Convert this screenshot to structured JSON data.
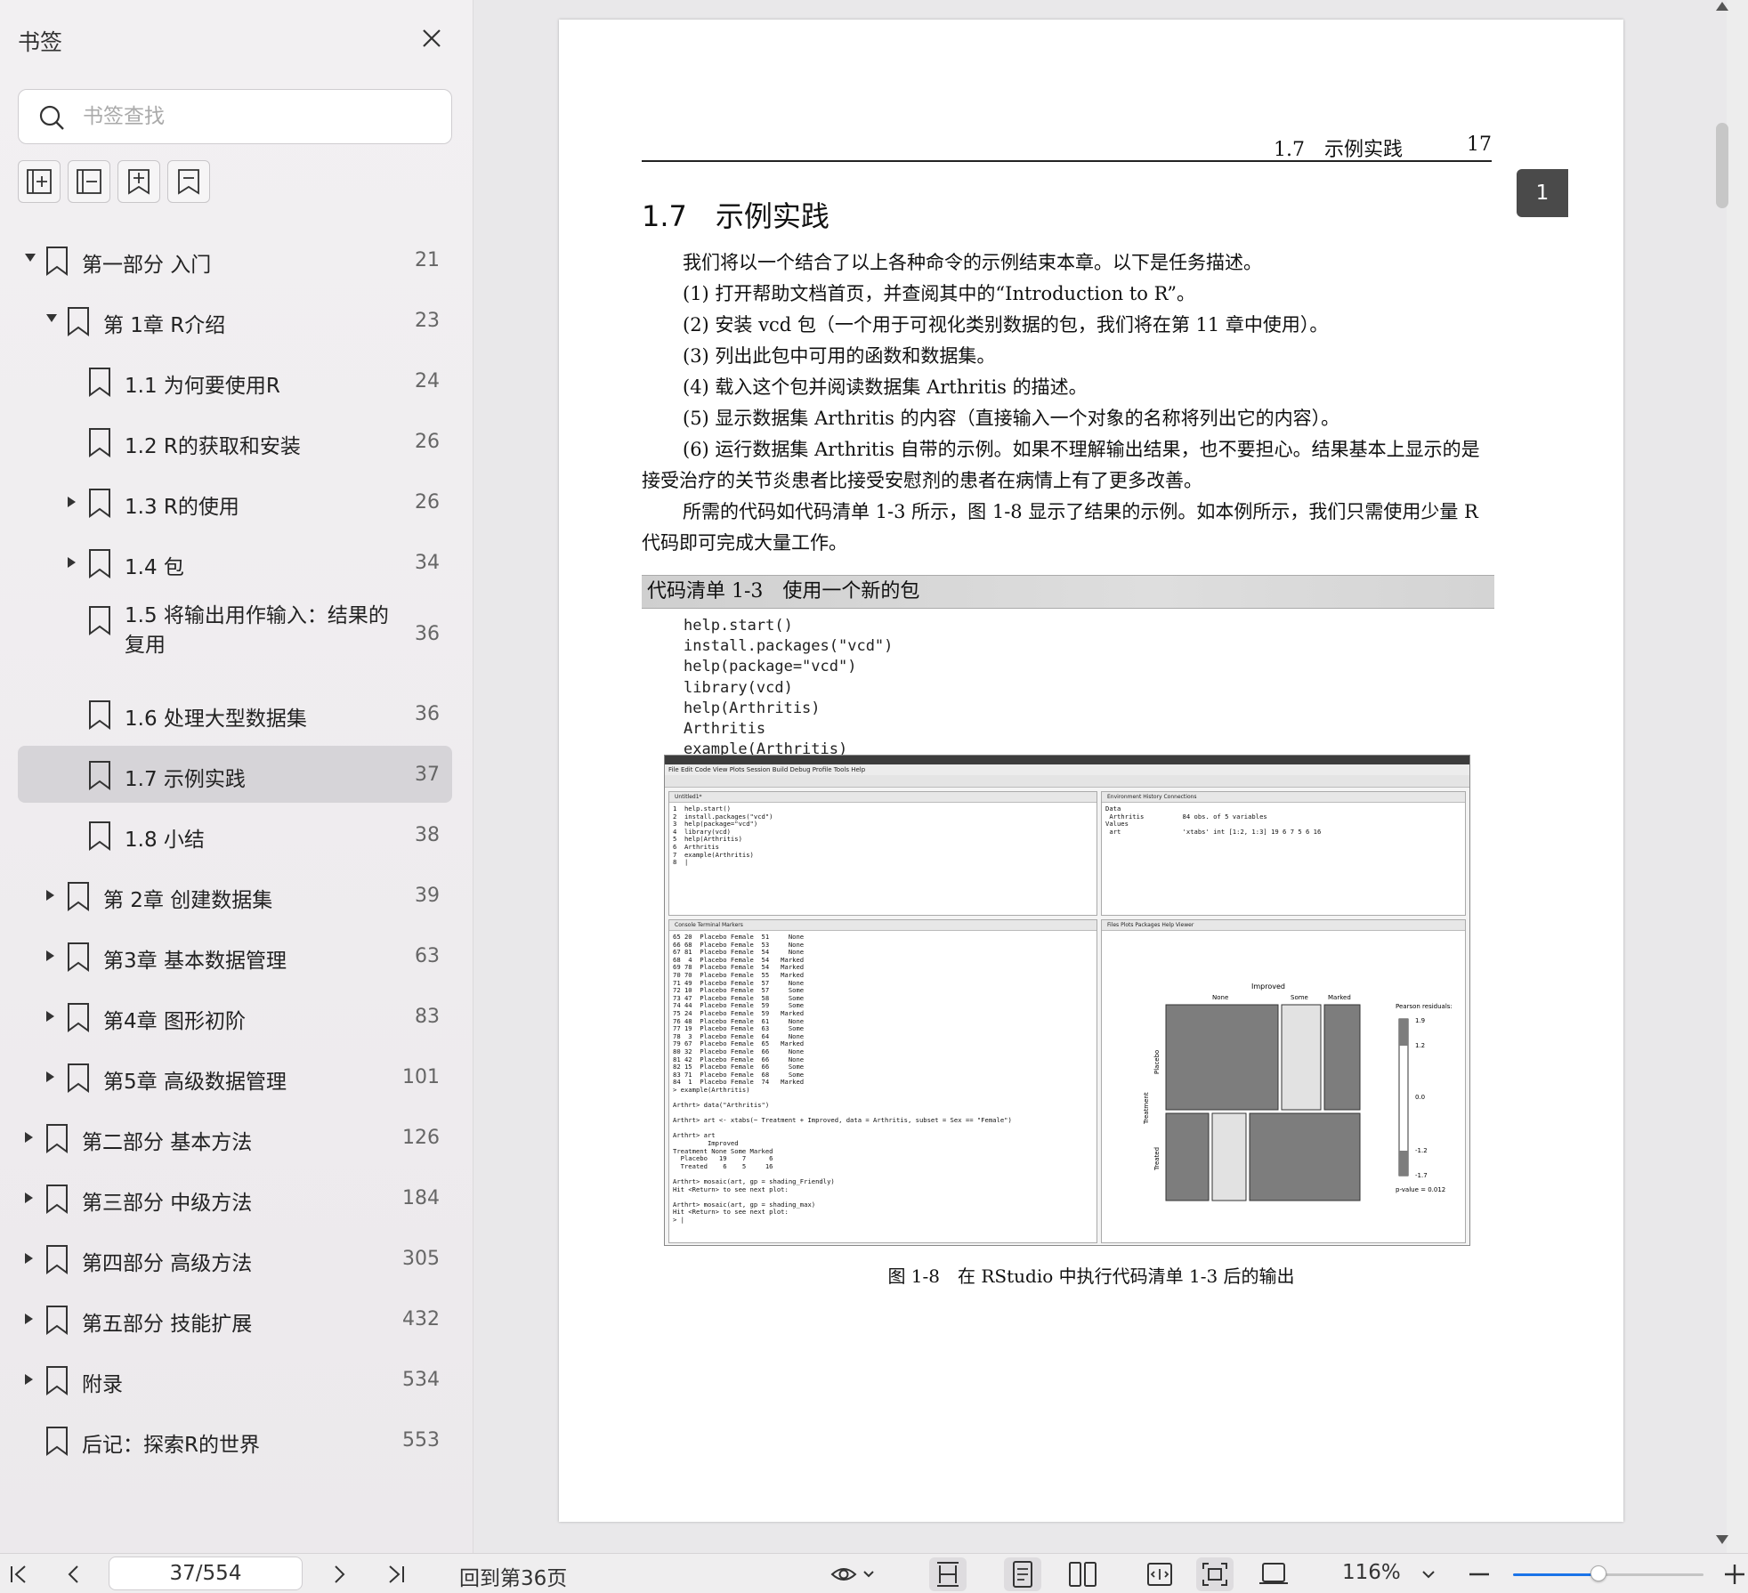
{
  "sidebar": {
    "title": "书签",
    "search_placeholder": "书签查找",
    "bookmarks": [
      {
        "label": "第一部分 入门",
        "page": "21",
        "level": 0,
        "arrow": "down"
      },
      {
        "label": "第 1章 R介绍",
        "page": "23",
        "level": 1,
        "arrow": "down"
      },
      {
        "label": "1.1 为何要使用R",
        "page": "24",
        "level": 2,
        "arrow": "none"
      },
      {
        "label": "1.2 R的获取和安装",
        "page": "26",
        "level": 2,
        "arrow": "none"
      },
      {
        "label": "1.3 R的使用",
        "page": "26",
        "level": 2,
        "arrow": "right"
      },
      {
        "label": "1.4 包",
        "page": "34",
        "level": 2,
        "arrow": "right"
      },
      {
        "label": "1.5 将输出用作输入：结果的复用",
        "page": "36",
        "level": 2,
        "arrow": "none"
      },
      {
        "label": "1.6 处理大型数据集",
        "page": "36",
        "level": 2,
        "arrow": "none"
      },
      {
        "label": "1.7 示例实践",
        "page": "37",
        "level": 2,
        "arrow": "none",
        "selected": true
      },
      {
        "label": "1.8 小结",
        "page": "38",
        "level": 2,
        "arrow": "none"
      },
      {
        "label": "第 2章 创建数据集",
        "page": "39",
        "level": 1,
        "arrow": "right"
      },
      {
        "label": "第3章 基本数据管理",
        "page": "63",
        "level": 1,
        "arrow": "right"
      },
      {
        "label": "第4章 图形初阶",
        "page": "83",
        "level": 1,
        "arrow": "right"
      },
      {
        "label": "第5章 高级数据管理",
        "page": "101",
        "level": 1,
        "arrow": "right"
      },
      {
        "label": "第二部分 基本方法",
        "page": "126",
        "level": 0,
        "arrow": "right"
      },
      {
        "label": "第三部分 中级方法",
        "page": "184",
        "level": 0,
        "arrow": "right"
      },
      {
        "label": "第四部分 高级方法",
        "page": "305",
        "level": 0,
        "arrow": "right"
      },
      {
        "label": "第五部分 技能扩展",
        "page": "432",
        "level": 0,
        "arrow": "right"
      },
      {
        "label": "附录",
        "page": "534",
        "level": 0,
        "arrow": "right"
      },
      {
        "label": "后记：探索R的世界",
        "page": "553",
        "level": 0,
        "arrow": "none"
      }
    ]
  },
  "page": {
    "running_head_section": "1.7　示例实践",
    "running_head_page": "17",
    "chapter_tab": "1",
    "section_title": "1.7　示例实践",
    "intro": "我们将以一个结合了以上各种命令的示例结束本章。以下是任务描述。",
    "steps": [
      "(1) 打开帮助文档首页，并查阅其中的“Introduction to R”。",
      "(2) 安装 vcd 包（一个用于可视化类别数据的包，我们将在第 11 章中使用）。",
      "(3) 列出此包中可用的函数和数据集。",
      "(4) 载入这个包并阅读数据集 Arthritis 的描述。",
      "(5) 显示数据集 Arthritis 的内容（直接输入一个对象的名称将列出它的内容）。",
      "(6) 运行数据集 Arthritis 自带的示例。如果不理解输出结果，也不要担心。结果基本上显示的是接受治疗的关节炎患者比接受安慰剂的患者在病情上有了更多改善。"
    ],
    "closing": "所需的代码如代码清单 1-3 所示，图 1-8 显示了结果的示例。如本例所示，我们只需使用少量 R 代码即可完成大量工作。",
    "listing_title": "代码清单 1-3　使用一个新的包",
    "code_lines": [
      "help.start()",
      "install.packages(\"vcd\")",
      "help(package=\"vcd\")",
      "library(vcd)",
      "help(Arthritis)",
      "Arthritis",
      "example(Arthritis)"
    ],
    "figure_caption": "图 1-8　在 RStudio 中执行代码清单 1-3 后的输出"
  },
  "figure": {
    "menu": "File  Edit  Code  View  Plots  Session  Build  Debug  Profile  Tools  Help",
    "editor_tab": "Untitled1*",
    "editor_lines": "1  help.start()\n2  install.packages(\"vcd\")\n3  help(package=\"vcd\")\n4  library(vcd)\n5  help(Arthritis)\n6  Arthritis\n7  example(Arthritis)\n8  |",
    "env_tabs": "Environment   History   Connections",
    "env_lines": "Data\n Arthritis          84 obs. of 5 variables\nValues\n art                'xtabs' int [1:2, 1:3] 19 6 7 5 6 16",
    "console_tabs": "Console   Terminal   Markers",
    "console_lines": "65 20  Placebo Female  51     None\n66 68  Placebo Female  53     None\n67 81  Placebo Female  54     None\n68  4  Placebo Female  54   Marked\n69 78  Placebo Female  54   Marked\n70 70  Placebo Female  55   Marked\n71 49  Placebo Female  57     None\n72 10  Placebo Female  57     Some\n73 47  Placebo Female  58     Some\n74 44  Placebo Female  59     Some\n75 24  Placebo Female  59   Marked\n76 48  Placebo Female  61     None\n77 19  Placebo Female  63     Some\n78  3  Placebo Female  64     None\n79 67  Placebo Female  65   Marked\n80 32  Placebo Female  66     None\n81 42  Placebo Female  66     None\n82 15  Placebo Female  66     Some\n83 71  Placebo Female  68     Some\n84  1  Placebo Female  74   Marked\n> example(Arthritis)\n\nArthrt> data(\"Arthritis\")\n\nArthrt> art <- xtabs(~ Treatment + Improved, data = Arthritis, subset = Sex == \"Female\")\n\nArthrt> art\n         Improved\nTreatment None Some Marked\n  Placebo   19    7      6\n  Treated    6    5     16\n\nArthrt> mosaic(art, gp = shading_Friendly)\nHit <Return> to see next plot:\n\nArthrt> mosaic(art, gp = shading_max)\nHit <Return> to see next plot:\n> |",
    "plots_tabs": "Files   Plots   Packages   Help   Viewer",
    "mosaic": {
      "improved_label": "Improved",
      "treatment_label": "Treatment",
      "col_labels": [
        "None",
        "Some",
        "Marked"
      ],
      "row_labels": [
        "Placebo",
        "Treated"
      ],
      "legend_title": "Pearson residuals:",
      "legend_ticks": [
        "1.9",
        "1.2",
        "0.0",
        "-1.2",
        "-1.7"
      ],
      "pvalue": "p-value = 0.012"
    }
  },
  "bottombar": {
    "page_field": "37/554",
    "goto": "回到第36页",
    "zoom": "116%",
    "zoom_fraction": 0.45
  },
  "colors": {
    "selection": "#d6d4d8",
    "accent": "#1a73e8",
    "mosaic_fill": "#7d7d7d",
    "mosaic_light": "#e2e2e2"
  }
}
